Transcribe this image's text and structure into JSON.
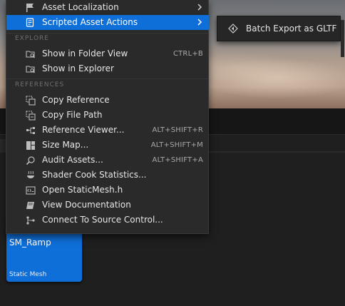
{
  "menu": {
    "items": [
      {
        "label": "Asset Localization",
        "shortcut": "",
        "submenu": true,
        "icon": "flag-icon"
      },
      {
        "label": "Scripted Asset Actions",
        "shortcut": "",
        "submenu": true,
        "icon": "script-icon",
        "highlighted": true
      }
    ],
    "sections": {
      "explore": {
        "header": "EXPLORE",
        "items": [
          {
            "label": "Show in Folder View",
            "shortcut": "CTRL+B",
            "icon": "folder-search-icon"
          },
          {
            "label": "Show in Explorer",
            "shortcut": "",
            "icon": "folder-search-icon"
          }
        ]
      },
      "references": {
        "header": "REFERENCES",
        "items": [
          {
            "label": "Copy Reference",
            "shortcut": "",
            "icon": "copy-icon"
          },
          {
            "label": "Copy File Path",
            "shortcut": "",
            "icon": "copy-path-icon"
          },
          {
            "label": "Reference Viewer...",
            "shortcut": "ALT+SHIFT+R",
            "icon": "reference-viewer-icon"
          },
          {
            "label": "Size Map...",
            "shortcut": "ALT+SHIFT+M",
            "icon": "size-map-icon"
          },
          {
            "label": "Audit Assets...",
            "shortcut": "ALT+SHIFT+A",
            "icon": "audit-icon"
          },
          {
            "label": "Shader Cook Statistics...",
            "shortcut": "",
            "icon": "shader-icon"
          },
          {
            "label": "Open StaticMesh.h",
            "shortcut": "",
            "icon": "code-file-icon"
          },
          {
            "label": "View Documentation",
            "shortcut": "",
            "icon": "documentation-icon"
          },
          {
            "label": "Connect To Source Control...",
            "shortcut": "",
            "icon": "source-control-icon"
          }
        ]
      }
    }
  },
  "submenu": {
    "item": {
      "label": "Batch Export as GLTF",
      "icon": "export-diamond-icon"
    }
  },
  "asset": {
    "name": "SM_Ramp",
    "type": "Static Mesh"
  },
  "colors": {
    "accent": "#0f6fd8",
    "menu_bg": "#2a2a2a",
    "text": "#e6e6e6",
    "shortcut": "#a8a8a8"
  }
}
